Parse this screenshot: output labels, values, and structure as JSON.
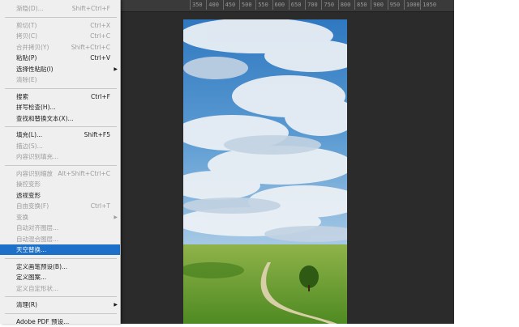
{
  "ruler_labels": [
    "350",
    "400",
    "450",
    "500",
    "550",
    "600",
    "650",
    "700",
    "750",
    "800",
    "850",
    "900",
    "950",
    "1000",
    "1050"
  ],
  "menu": [
    {
      "label": "渐隐(D)...",
      "shortcut": "Shift+Ctrl+F",
      "enabled": false
    },
    {
      "separator": true
    },
    {
      "label": "剪切(T)",
      "shortcut": "Ctrl+X",
      "enabled": false
    },
    {
      "label": "拷贝(C)",
      "shortcut": "Ctrl+C",
      "enabled": false
    },
    {
      "label": "合并拷贝(Y)",
      "shortcut": "Shift+Ctrl+C",
      "enabled": false
    },
    {
      "label": "粘贴(P)",
      "shortcut": "Ctrl+V",
      "enabled": true
    },
    {
      "label": "选择性粘贴(I)",
      "shortcut": "",
      "enabled": true,
      "submenu": true
    },
    {
      "label": "清除(E)",
      "shortcut": "",
      "enabled": false
    },
    {
      "separator": true
    },
    {
      "label": "搜索",
      "shortcut": "Ctrl+F",
      "enabled": true
    },
    {
      "label": "拼写检查(H)...",
      "shortcut": "",
      "enabled": true
    },
    {
      "label": "查找和替换文本(X)...",
      "shortcut": "",
      "enabled": true
    },
    {
      "separator": true
    },
    {
      "label": "填充(L)...",
      "shortcut": "Shift+F5",
      "enabled": true
    },
    {
      "label": "描边(S)...",
      "shortcut": "",
      "enabled": false
    },
    {
      "label": "内容识别填充...",
      "shortcut": "",
      "enabled": false
    },
    {
      "separator": true
    },
    {
      "label": "内容识别缩放",
      "shortcut": "Alt+Shift+Ctrl+C",
      "enabled": false
    },
    {
      "label": "操控变形",
      "shortcut": "",
      "enabled": false
    },
    {
      "label": "透视变形",
      "shortcut": "",
      "enabled": true
    },
    {
      "label": "自由变换(F)",
      "shortcut": "Ctrl+T",
      "enabled": false
    },
    {
      "label": "变换",
      "shortcut": "",
      "enabled": false,
      "submenu": true
    },
    {
      "label": "自动对齐图层...",
      "shortcut": "",
      "enabled": false
    },
    {
      "label": "自动混合图层...",
      "shortcut": "",
      "enabled": false
    },
    {
      "label": "天空替换...",
      "shortcut": "",
      "enabled": true,
      "highlighted": true
    },
    {
      "separator": true
    },
    {
      "label": "定义画笔预设(B)...",
      "shortcut": "",
      "enabled": true
    },
    {
      "label": "定义图案...",
      "shortcut": "",
      "enabled": true
    },
    {
      "label": "定义自定形状...",
      "shortcut": "",
      "enabled": false
    },
    {
      "separator": true
    },
    {
      "label": "清理(R)",
      "shortcut": "",
      "enabled": true,
      "submenu": true
    },
    {
      "separator": true
    },
    {
      "label": "Adobe PDF 预设...",
      "shortcut": "",
      "enabled": true
    }
  ]
}
